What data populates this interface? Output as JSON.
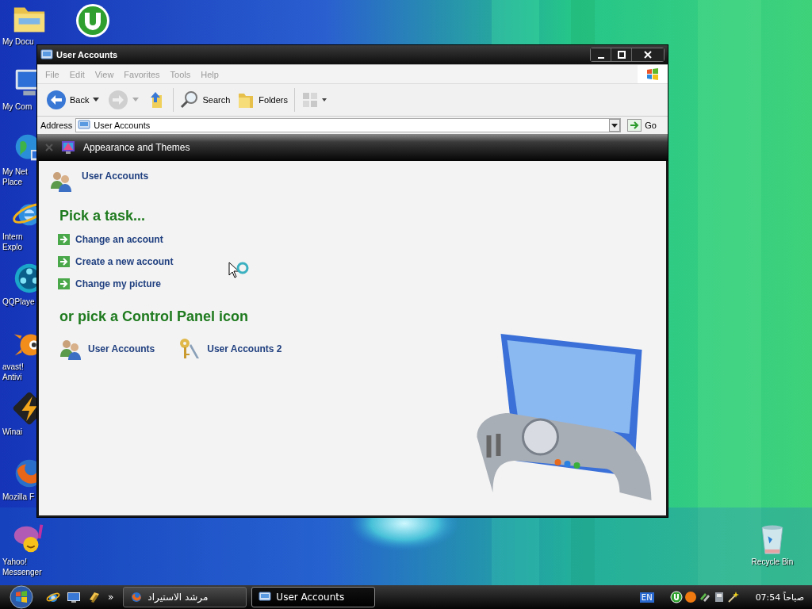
{
  "desktop": {
    "icons": [
      {
        "label": [
          "My Docu"
        ],
        "kind": "folder"
      },
      {
        "label": [
          "My Com"
        ],
        "kind": "computer"
      },
      {
        "label": [
          "My Net",
          "Place"
        ],
        "kind": "network"
      },
      {
        "label": [
          "Intern",
          "Explo"
        ],
        "kind": "ie"
      },
      {
        "label": [
          "QQPlaye"
        ],
        "kind": "player"
      },
      {
        "label": [
          "avast!",
          "Antivi"
        ],
        "kind": "avast"
      },
      {
        "label": [
          "Winai"
        ],
        "kind": "winamp"
      },
      {
        "label": [
          "Mozilla F"
        ],
        "kind": "firefox"
      },
      {
        "label": [
          "Yahoo!",
          "Messenger"
        ],
        "kind": "yahoo"
      }
    ],
    "top_icons": [
      {
        "kind": "torrent"
      }
    ],
    "right_icons": [
      {
        "label": [
          "Recycle Bin"
        ],
        "kind": "bin"
      }
    ]
  },
  "window": {
    "title": "User Accounts",
    "menu": [
      "File",
      "Edit",
      "View",
      "Favorites",
      "Tools",
      "Help"
    ],
    "toolbar": [
      {
        "kind": "back",
        "label": "Back"
      },
      {
        "kind": "forward"
      },
      {
        "kind": "up"
      },
      {
        "kind": "search",
        "label": "Search"
      },
      {
        "kind": "folders",
        "label": "Folders"
      },
      {
        "kind": "views"
      }
    ],
    "address": {
      "label": "Address",
      "value": "User Accounts",
      "go": "Go"
    },
    "band": {
      "title": "Appearance and Themes"
    },
    "content": {
      "header": "User Accounts",
      "tasks_title": "Pick a task...",
      "tasks": [
        "Change an account",
        "Create a new account",
        "Change my picture"
      ],
      "icons_title": "or pick a Control Panel icon",
      "icons": [
        {
          "label": "User Accounts",
          "kind": "users"
        },
        {
          "label": "User Accounts 2",
          "kind": "keys"
        }
      ]
    }
  },
  "taskbar": {
    "quick_launch": [
      {
        "kind": "ie"
      },
      {
        "kind": "desktop"
      },
      {
        "kind": "switch"
      }
    ],
    "overflow": "»",
    "tasks": [
      {
        "label": "مرشد الاستيراد",
        "kind": "firefox",
        "selected": false
      },
      {
        "label": "User Accounts",
        "kind": "window",
        "selected": true
      }
    ],
    "language": "EN",
    "tray": [
      {
        "kind": "torrent"
      },
      {
        "kind": "orange"
      },
      {
        "kind": "network"
      },
      {
        "kind": "device"
      },
      {
        "kind": "wand"
      }
    ],
    "clock": "07:54 صباحاً"
  }
}
